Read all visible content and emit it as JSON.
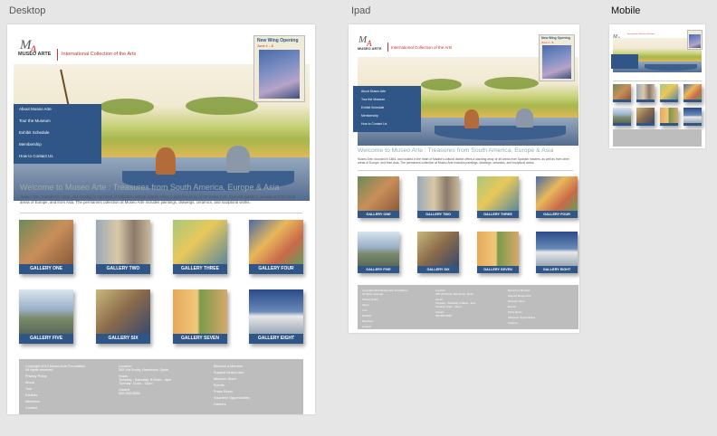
{
  "labels": {
    "desktop": "Desktop",
    "ipad": "Ipad",
    "mobile": "Mobile"
  },
  "site": {
    "logo_text": "MUSEO ARTE",
    "tagline": "International Collection of the Arts",
    "promo_title": "New Wing Opening",
    "promo_sub": "June 1 - 8",
    "menu": [
      "About Museo Arte",
      "Tour the Museum",
      "Exhibit Schedule",
      "Membership",
      "How to Contact Us"
    ],
    "welcome": "Welcome to Museo Arte : Treasures from South America, Europe & Asia",
    "intro": "Museo Arte, founded in 1864, and located in the heart of Madrid's cultural district offers a dazzling array of art works from Spanish masters, as well as from other areas of Europe, and from Asia. The permanent collection at Museo Arte includes paintings, drawings, ceramics, and sculptural works.",
    "galleries": [
      "GALLERY ONE",
      "GALLERY TWO",
      "GALLERY THREE",
      "GALLERY FOUR",
      "GALLERY FIVE",
      "GALLERY SIX",
      "GALLERY SEVEN",
      "GALLERY EIGHT"
    ],
    "footer": {
      "col1": [
        "Copyright 2012 Museo Arte Foundation",
        "All rights reserved",
        "Privacy Policy",
        "About",
        "Tour",
        "Exhibits",
        "Members",
        "Contact"
      ],
      "col2": [
        "Location",
        "345 Via Rocky, Barcelona, Spain",
        "Hours",
        "Tuesday - Saturday, 9:00am - 4pm",
        "Tue/day: 11am - 11pm",
        "Closed",
        "555-555-5555"
      ],
      "col3": [
        "Become a Member",
        "Support Museo Arte",
        "Museum Store",
        "Events",
        "Press Room",
        "Volunteer Opportunities",
        "Careers"
      ]
    }
  },
  "colors": {
    "nav_blue": "#2f5686",
    "accent_red": "#c8332a",
    "footer_gray": "#bdbdbd",
    "canvas": "#e6e6e6"
  }
}
